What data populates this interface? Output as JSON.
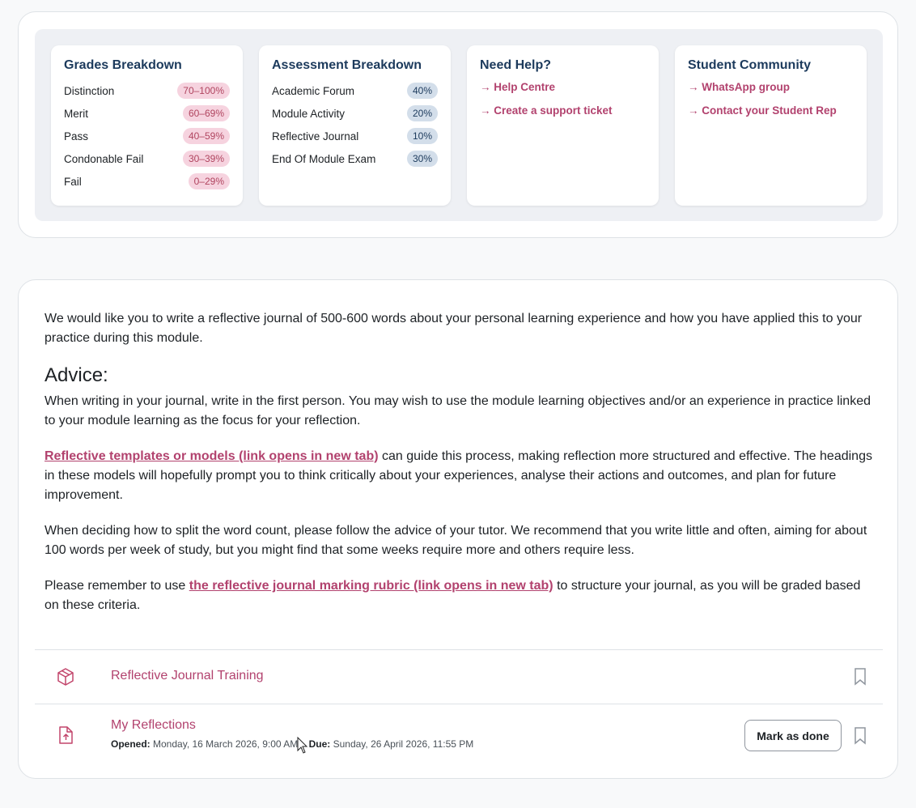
{
  "grades": {
    "title": "Grades Breakdown",
    "items": [
      {
        "label": "Distinction",
        "value": "70–100%"
      },
      {
        "label": "Merit",
        "value": "60–69%"
      },
      {
        "label": "Pass",
        "value": "40–59%"
      },
      {
        "label": "Condonable Fail",
        "value": "30–39%"
      },
      {
        "label": "Fail",
        "value": "0–29%"
      }
    ]
  },
  "assessment": {
    "title": "Assessment Breakdown",
    "items": [
      {
        "label": "Academic Forum",
        "value": "40%"
      },
      {
        "label": "Module Activity",
        "value": "20%"
      },
      {
        "label": "Reflective Journal",
        "value": "10%"
      },
      {
        "label": "End Of Module Exam",
        "value": "30%"
      }
    ]
  },
  "help": {
    "title": "Need Help?",
    "links": [
      "→ Help Centre",
      "→ Create a support ticket"
    ]
  },
  "community": {
    "title": "Student Community",
    "links": [
      "→ WhatsApp group",
      "→ Contact your Student Rep"
    ]
  },
  "main": {
    "intro": "We would like you to write a reflective journal of 500-600 words about your personal learning experience and how you have applied this to your practice during this module.",
    "advice_heading": "Advice:",
    "p1": "When writing in your journal, write in the first person. You may wish to use the module learning objectives and/or an experience in practice linked to your module learning as the focus for your reflection.",
    "p2_link": "Reflective templates or models (link opens in new tab)",
    "p2_rest": " can guide this process, making reflection more structured and effective. The headings in these models will hopefully prompt you to think critically about your experiences, analyse their actions and outcomes, and plan for future improvement.",
    "p3": "When deciding how to split the word count, please follow the advice of your tutor. We recommend that you write little and often, aiming for about 100 words per week of study, but you might find that some weeks require more and others require less.",
    "p4_before": "Please remember to use ",
    "p4_link": "the reflective journal marking rubric (link opens in new tab)",
    "p4_after": " to structure your journal, as you will be graded based on these criteria."
  },
  "activities": {
    "training": {
      "title": "Reflective Journal Training",
      "icon": "package-icon"
    },
    "reflections": {
      "title": "My Reflections",
      "icon": "upload-file-icon",
      "opened_label": "Opened:",
      "opened": "Monday, 16 March 2026, 9:00 AM",
      "due_label": "Due:",
      "due": "Sunday, 26 April 2026, 11:55 PM",
      "button": "Mark as done"
    }
  },
  "colors": {
    "accent": "#b2426e",
    "heading": "#1c3a5c"
  }
}
